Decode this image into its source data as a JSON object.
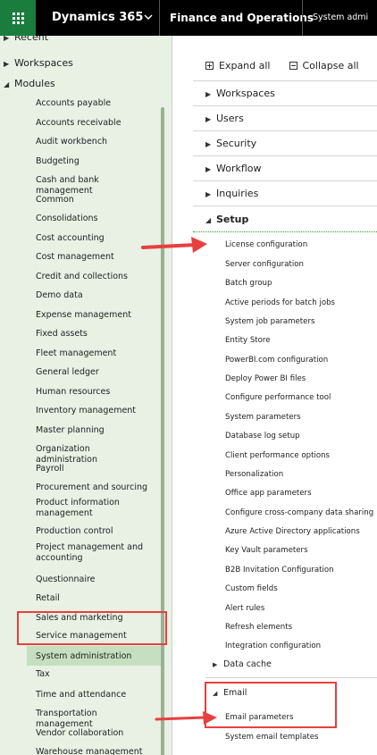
{
  "topbar": {
    "app_title": "Dynamics 365",
    "fo_title": "Finance and Operations",
    "sys_title": "System admi"
  },
  "leftnav": {
    "recent": "Recent",
    "workspaces": "Workspaces",
    "modules": "Modules",
    "items": [
      "Accounts payable",
      "Accounts receivable",
      "Audit workbench",
      "Budgeting",
      "Cash and bank management",
      "Common",
      "Consolidations",
      "Cost accounting",
      "Cost management",
      "Credit and collections",
      "Demo data",
      "Expense management",
      "Fixed assets",
      "Fleet management",
      "General ledger",
      "Human resources",
      "Inventory management",
      "Master planning",
      "Organization administration",
      "Payroll",
      "Procurement and sourcing",
      "Product information management",
      "Production control",
      "Project management and accounting",
      "Questionnaire",
      "Retail",
      "Sales and marketing",
      "Service management",
      "System administration",
      "Tax",
      "Time and attendance",
      "Transportation management",
      "Vendor collaboration",
      "Warehouse management"
    ]
  },
  "content": {
    "expand_all": "Expand all",
    "collapse_all": "Collapse all",
    "sections": [
      "Workspaces",
      "Users",
      "Security",
      "Workflow",
      "Inquiries",
      "Setup"
    ],
    "setup_links": [
      "License configuration",
      "Server configuration",
      "Batch group",
      "Active periods for batch jobs",
      "System job parameters",
      "Entity Store",
      "PowerBI.com configuration",
      "Deploy Power BI files",
      "Configure performance tool",
      "System parameters",
      "Database log setup",
      "Client performance options",
      "Personalization",
      "Office app parameters",
      "Configure cross-company data sharing",
      "Azure Active Directory applications",
      "Key Vault parameters",
      "B2B Invitation Configuration",
      "Custom fields",
      "Alert rules",
      "Refresh elements",
      "Integration configuration"
    ],
    "data_cache": "Data cache",
    "email": "Email",
    "email_links": [
      "Email parameters",
      "System email templates"
    ]
  },
  "colors": {
    "topbar_bg": "#000000",
    "waffle_bg": "#1a7c3d",
    "leftnav_bg": "#e8f1e4",
    "selected_bg": "#c6dfc1",
    "highlight": "#e83f3f"
  },
  "icons": [
    "waffle-icon",
    "chevron-down-icon",
    "expand-all-icon",
    "collapse-all-icon",
    "triangle-right-icon",
    "triangle-down-icon"
  ]
}
